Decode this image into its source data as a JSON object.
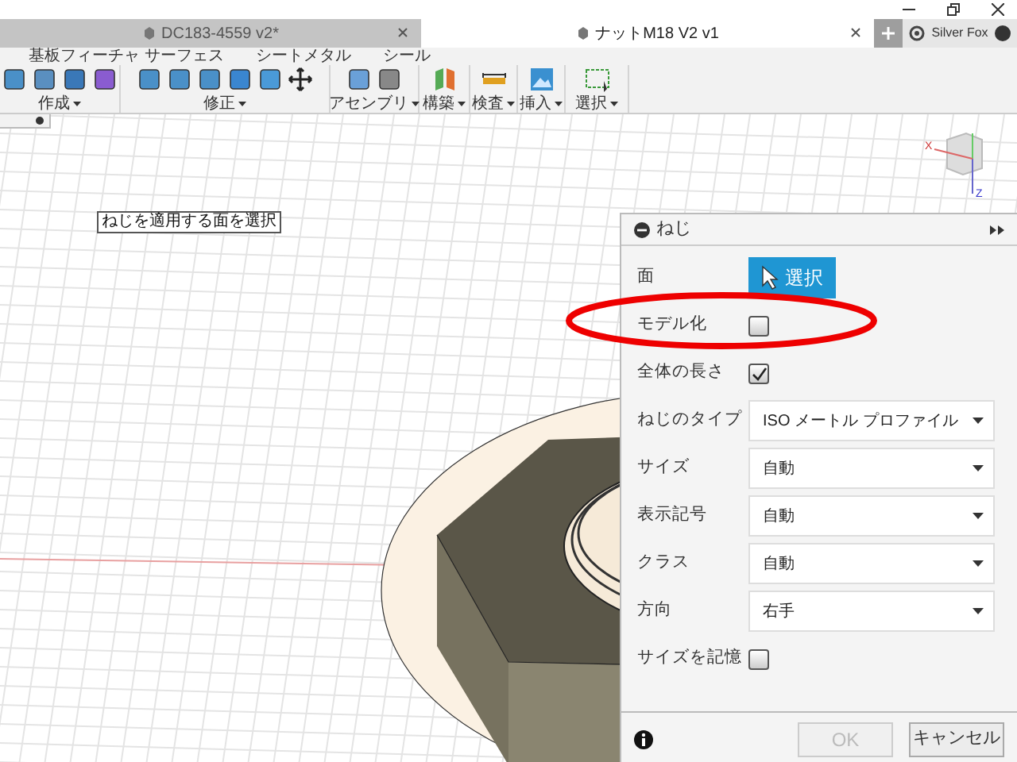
{
  "tabs": [
    {
      "label": "DC183-4559 v2*",
      "selected": false
    },
    {
      "label": "ナットM18 V2 v1",
      "selected": true
    }
  ],
  "user": "Silver Fox",
  "toolbar": {
    "top_labels": [
      "基板フィーチャ サーフェス",
      "シートメタル",
      "シール"
    ],
    "groups": [
      {
        "label": "作成"
      },
      {
        "label": "修正"
      },
      {
        "label": "アセンブリ"
      },
      {
        "label": "構築"
      },
      {
        "label": "検査"
      },
      {
        "label": "挿入"
      },
      {
        "label": "選択"
      }
    ]
  },
  "canvas": {
    "tooltip": "ねじを適用する面を選択",
    "viewcube_axes": [
      "X",
      "Z"
    ]
  },
  "dialog": {
    "title": "ねじ",
    "rows": [
      {
        "kind": "select",
        "label": "面",
        "value": "選択"
      },
      {
        "kind": "checkbox",
        "label": "モデル化",
        "checked": false
      },
      {
        "kind": "checkbox",
        "label": "全体の長さ",
        "checked": true
      },
      {
        "kind": "dropdown",
        "label": "ねじのタイプ",
        "value": "ISO メートル プロファイル"
      },
      {
        "kind": "dropdown",
        "label": "サイズ",
        "value": "自動"
      },
      {
        "kind": "dropdown",
        "label": "表示記号",
        "value": "自動"
      },
      {
        "kind": "dropdown",
        "label": "クラス",
        "value": "自動"
      },
      {
        "kind": "dropdown",
        "label": "方向",
        "value": "右手"
      },
      {
        "kind": "checkbox",
        "label": "サイズを記憶",
        "checked": false
      }
    ],
    "buttons": [
      {
        "label": "OK",
        "disabled": true
      },
      {
        "label": "キャンセル",
        "disabled": false
      }
    ]
  }
}
